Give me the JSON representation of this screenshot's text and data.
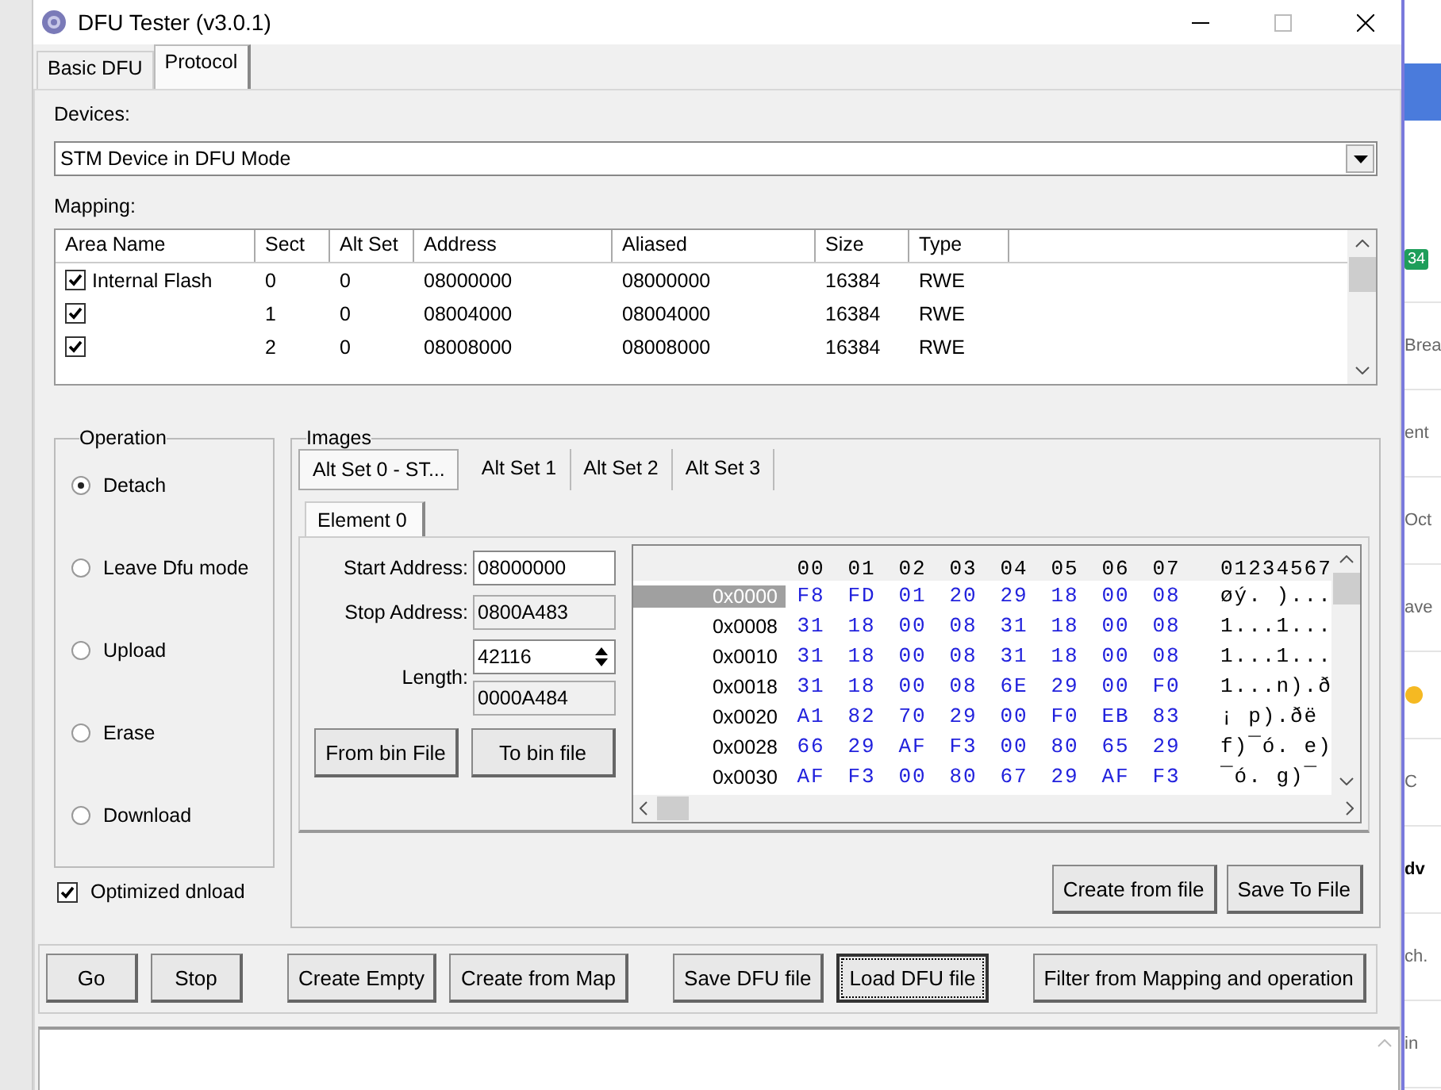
{
  "window": {
    "title": "DFU Tester (v3.0.1)"
  },
  "tabs": [
    {
      "label": "Basic DFU",
      "selected": false
    },
    {
      "label": "Protocol",
      "selected": true
    }
  ],
  "devices": {
    "label": "Devices:",
    "value": "STM Device in DFU Mode"
  },
  "mapping": {
    "label": "Mapping:",
    "columns": [
      "Area Name",
      "Sect",
      "Alt Set",
      "Address",
      "Aliased",
      "Size",
      "Type"
    ],
    "rows": [
      {
        "checked": true,
        "cells": [
          "Internal Flash",
          "0",
          "0",
          "08000000",
          "08000000",
          "16384",
          "RWE"
        ]
      },
      {
        "checked": true,
        "cells": [
          "",
          "1",
          "0",
          "08004000",
          "08004000",
          "16384",
          "RWE"
        ]
      },
      {
        "checked": true,
        "cells": [
          "",
          "2",
          "0",
          "08008000",
          "08008000",
          "16384",
          "RWE"
        ]
      }
    ]
  },
  "operation": {
    "title": "Operation",
    "options": [
      {
        "label": "Detach",
        "selected": true
      },
      {
        "label": "Leave Dfu mode",
        "selected": false
      },
      {
        "label": "Upload",
        "selected": false
      },
      {
        "label": "Erase",
        "selected": false
      },
      {
        "label": "Download",
        "selected": false
      }
    ],
    "optimized": {
      "label": "Optimized dnload",
      "checked": true
    }
  },
  "images": {
    "title": "Images",
    "alt_tabs": [
      {
        "label": "Alt Set 0 - ST...",
        "selected": true
      },
      {
        "label": "Alt Set 1",
        "selected": false
      },
      {
        "label": "Alt Set 2",
        "selected": false
      },
      {
        "label": "Alt Set 3",
        "selected": false
      }
    ],
    "element_tab": {
      "label": "Element 0"
    },
    "start_address": {
      "label": "Start Address:",
      "value": "08000000"
    },
    "stop_address": {
      "label": "Stop Address:",
      "value": "0800A483"
    },
    "length": {
      "label": "Length:",
      "value": "42116",
      "hex": "0000A484"
    },
    "file_buttons": [
      "From bin File",
      "To bin file"
    ],
    "hex": {
      "columns": [
        "00",
        "01",
        "02",
        "03",
        "04",
        "05",
        "06",
        "07"
      ],
      "ascii_header": "01234567",
      "rows": [
        {
          "offset": "0x0000",
          "selected": true,
          "bytes": [
            "F8",
            "FD",
            "01",
            "20",
            "29",
            "18",
            "00",
            "08"
          ],
          "ascii": "øý. )..."
        },
        {
          "offset": "0x0008",
          "selected": false,
          "bytes": [
            "31",
            "18",
            "00",
            "08",
            "31",
            "18",
            "00",
            "08"
          ],
          "ascii": "1...1..."
        },
        {
          "offset": "0x0010",
          "selected": false,
          "bytes": [
            "31",
            "18",
            "00",
            "08",
            "31",
            "18",
            "00",
            "08"
          ],
          "ascii": "1...1..."
        },
        {
          "offset": "0x0018",
          "selected": false,
          "bytes": [
            "31",
            "18",
            "00",
            "08",
            "6E",
            "29",
            "00",
            "F0"
          ],
          "ascii": "1...n).ð"
        },
        {
          "offset": "0x0020",
          "selected": false,
          "bytes": [
            "A1",
            "82",
            "70",
            "29",
            "00",
            "F0",
            "EB",
            "83"
          ],
          "ascii": "¡ p).ðë"
        },
        {
          "offset": "0x0028",
          "selected": false,
          "bytes": [
            "66",
            "29",
            "AF",
            "F3",
            "00",
            "80",
            "65",
            "29"
          ],
          "ascii": "f)¯ó. e)"
        },
        {
          "offset": "0x0030",
          "selected": false,
          "bytes": [
            "AF",
            "F3",
            "00",
            "80",
            "67",
            "29",
            "AF",
            "F3"
          ],
          "ascii": "¯ó. g)¯"
        }
      ]
    },
    "image_buttons": [
      "Create from file",
      "Save To File"
    ]
  },
  "actions": [
    {
      "label": "Go",
      "focused": false
    },
    {
      "label": "Stop",
      "focused": false
    },
    {
      "label": "Create Empty",
      "focused": false
    },
    {
      "label": "Create from Map",
      "focused": false
    },
    {
      "label": "Save DFU file",
      "focused": false
    },
    {
      "label": "Load DFU file",
      "focused": true
    },
    {
      "label": "Filter from Mapping and operation",
      "focused": false
    }
  ],
  "background": {
    "fragments": [
      {
        "kind": "badge",
        "text": "34"
      },
      {
        "kind": "text",
        "text": "Brea"
      },
      {
        "kind": "text",
        "text": "ent"
      },
      {
        "kind": "text",
        "text": "Oct"
      },
      {
        "kind": "text",
        "text": "ave"
      },
      {
        "kind": "emoji"
      },
      {
        "kind": "text",
        "text": "C"
      },
      {
        "kind": "bold",
        "text": "dv"
      },
      {
        "kind": "text",
        "text": "ch."
      },
      {
        "kind": "text",
        "text": "in"
      }
    ]
  }
}
